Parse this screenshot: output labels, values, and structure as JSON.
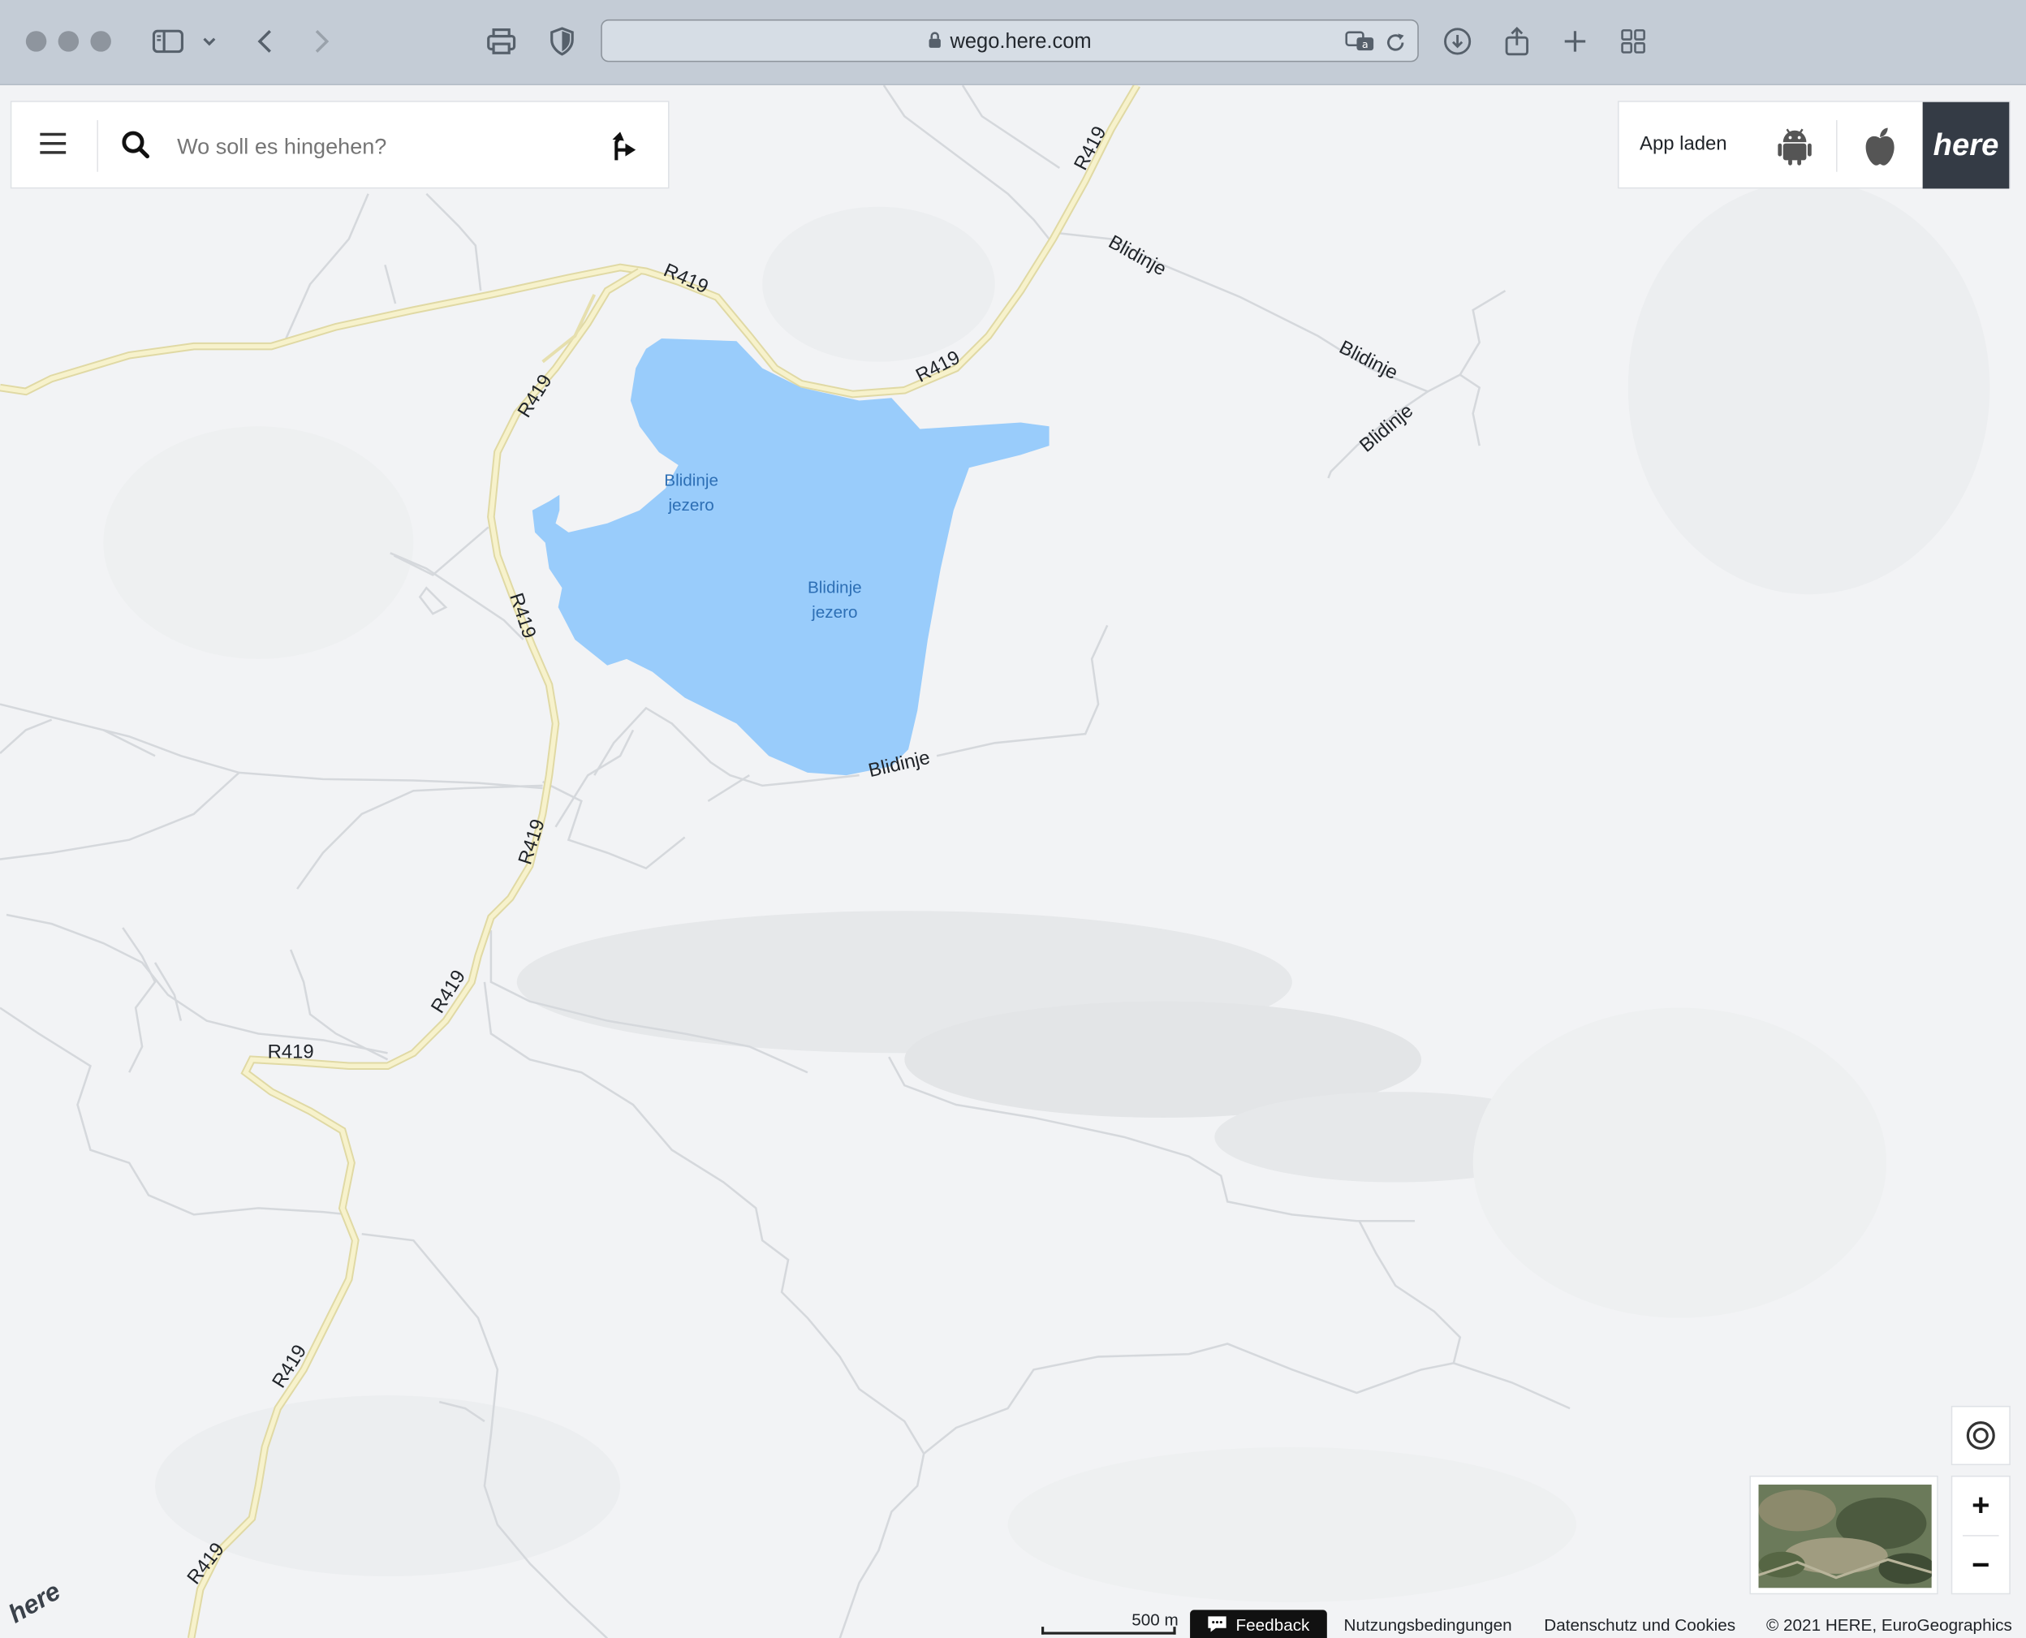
{
  "browser": {
    "url": "wego.here.com"
  },
  "search": {
    "placeholder": "Wo soll es hingehen?"
  },
  "app_promo": {
    "label": "App laden",
    "logo_text": "here"
  },
  "map": {
    "lake_labels": [
      {
        "line1": "Blidinje",
        "line2": "jezero"
      },
      {
        "line1": "Blidinje",
        "line2": "jezero"
      }
    ],
    "road_labels": [
      "R419",
      "R419",
      "R419",
      "R419",
      "R419",
      "R419",
      "R419",
      "R419",
      "R419",
      "R419",
      "Blidinje",
      "Blidinje",
      "Blidinje",
      "Blidinje"
    ],
    "watermark": "here"
  },
  "controls": {
    "zoom_in": "+",
    "zoom_out": "−"
  },
  "footer": {
    "scale": "500 m",
    "feedback": "Feedback",
    "terms": "Nutzungsbedingungen",
    "privacy": "Datenschutz und Cookies",
    "copyright": "© 2021 HERE, EuroGeographics"
  },
  "colors": {
    "water": "#99ccfb",
    "water_label": "#2d6fb5",
    "highway": "#f5efc4",
    "highway_casing": "#e4dca6",
    "minor_road": "#d9dcdf",
    "land": "#f2f3f5",
    "chrome": "#c4ccd6"
  }
}
